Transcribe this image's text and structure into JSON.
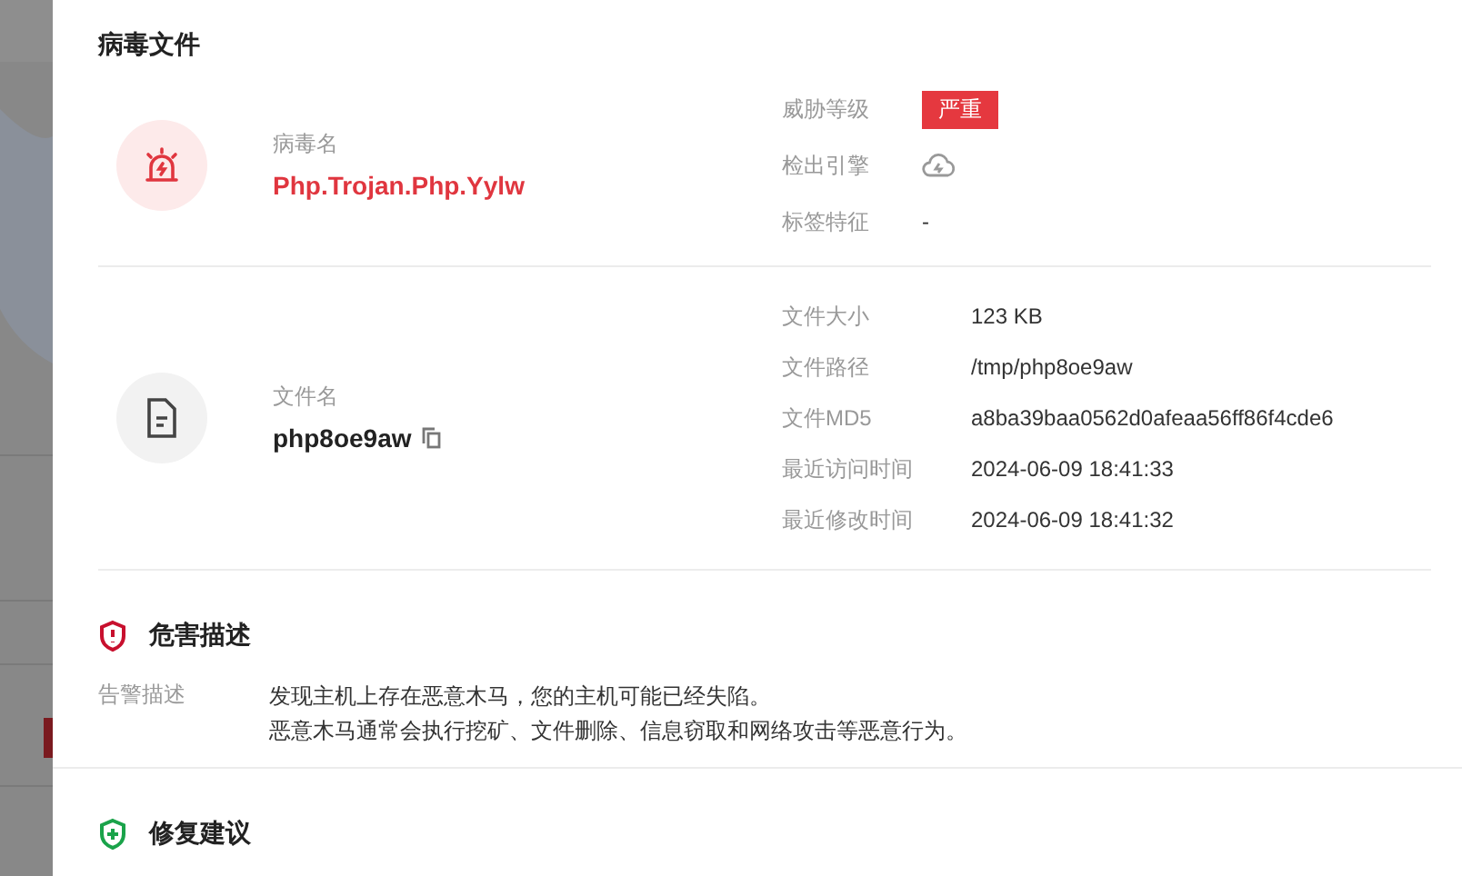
{
  "title": "病毒文件",
  "virus": {
    "label": "病毒名",
    "name": "Php.Trojan.Php.Yylw",
    "details": [
      {
        "kind": "badge",
        "label": "威胁等级",
        "value": "严重"
      },
      {
        "kind": "engine",
        "label": "检出引擎"
      },
      {
        "kind": "text",
        "label": "标签特征",
        "value": "-"
      }
    ]
  },
  "file": {
    "label": "文件名",
    "name": "php8oe9aw",
    "details": [
      {
        "kind": "text",
        "label": "文件大小",
        "value": "123 KB"
      },
      {
        "kind": "text",
        "label": "文件路径",
        "value": "/tmp/php8oe9aw"
      },
      {
        "kind": "text",
        "label": "文件MD5",
        "value": "a8ba39baa0562d0afeaa56ff86f4cde6"
      },
      {
        "kind": "text",
        "label": "最近访问时间",
        "value": "2024-06-09 18:41:33"
      },
      {
        "kind": "text",
        "label": "最近修改时间",
        "value": "2024-06-09 18:41:32"
      }
    ]
  },
  "sections": [
    {
      "kind": "danger",
      "title": "危害描述",
      "rows": [
        {
          "label": "告警描述",
          "lines": [
            "发现主机上存在恶意木马，您的主机可能已经失陷。",
            "恶意木马通常会执行挖矿、文件删除、信息窃取和网络攻击等恶意行为。"
          ]
        }
      ]
    },
    {
      "kind": "fix",
      "title": "修复建议"
    }
  ]
}
